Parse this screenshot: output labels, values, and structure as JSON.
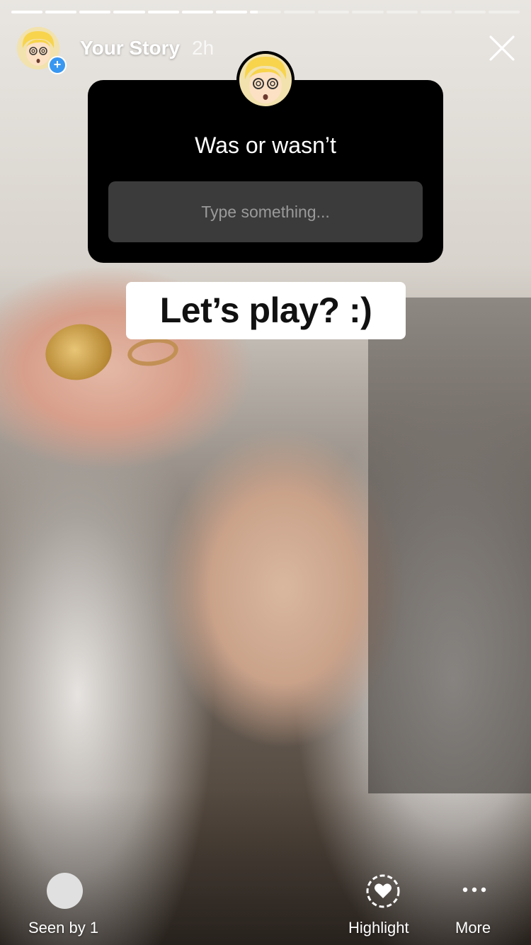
{
  "story": {
    "title": "Your Story",
    "time": "2h",
    "segments_total": 15,
    "segments_complete": 7,
    "current_segment_progress": 0.25
  },
  "sticker": {
    "question": "Was or wasn’t",
    "input_placeholder": "Type something..."
  },
  "caption": {
    "text": "Let’s play? :)"
  },
  "footer": {
    "seen_label": "Seen by 1",
    "highlight_label": "Highlight",
    "more_label": "More"
  },
  "icons": {
    "avatar": "memoji-avatar-icon",
    "add": "plus-icon",
    "close": "close-icon",
    "highlight": "heart-circle-icon",
    "more": "ellipsis-icon"
  },
  "colors": {
    "badge_blue": "#3897f0",
    "sticker_bg": "#000000",
    "input_bg": "#3b3b3b"
  }
}
